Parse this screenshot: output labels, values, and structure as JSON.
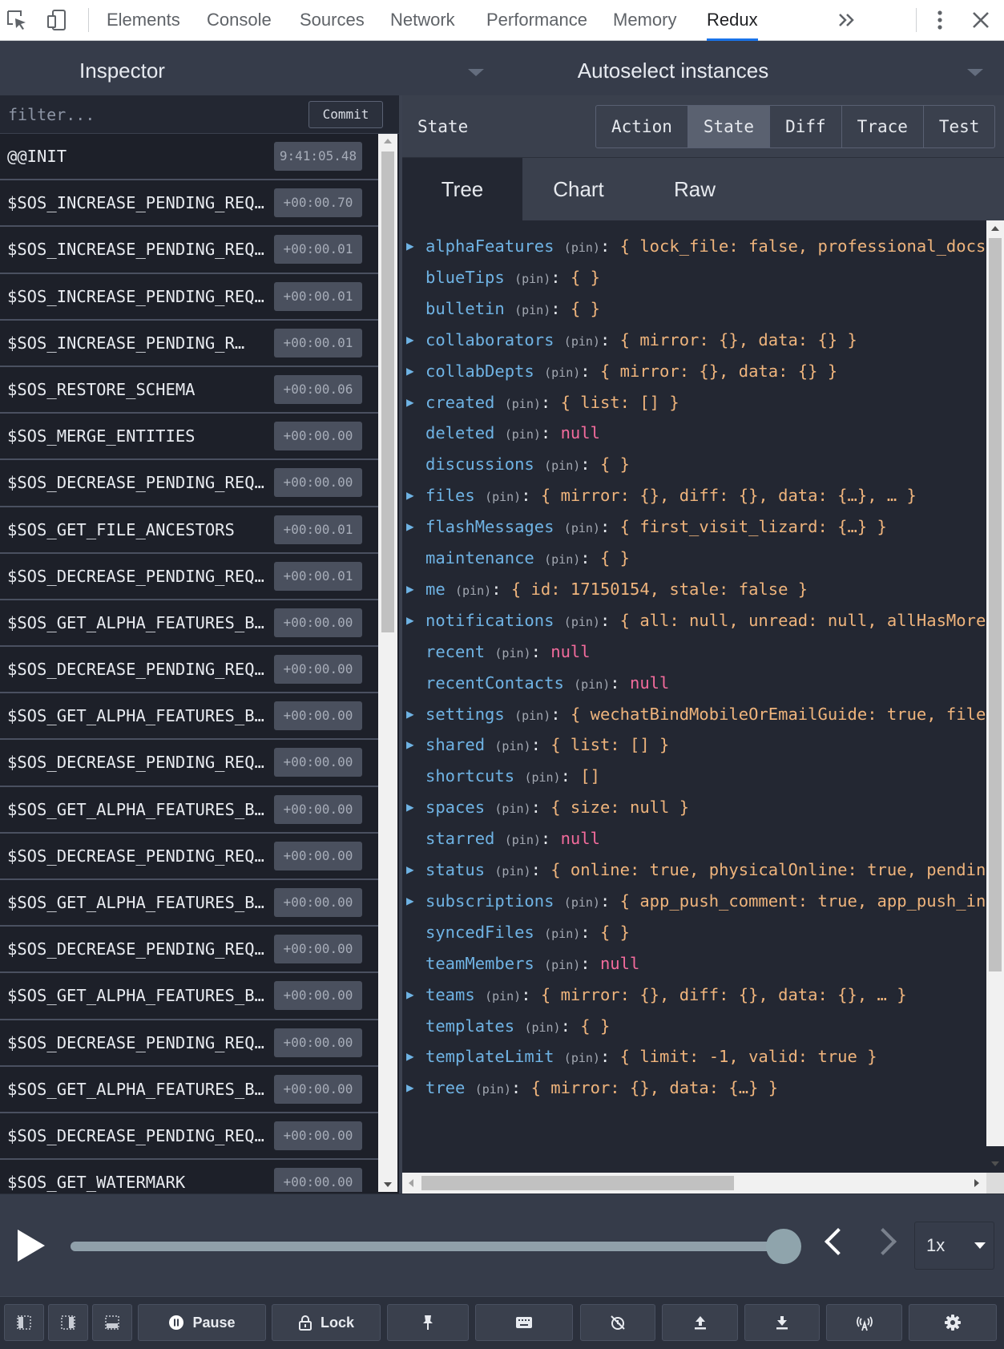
{
  "devtools": {
    "tabs": [
      "Elements",
      "Console",
      "Sources",
      "Network",
      "Performance",
      "Memory",
      "Redux"
    ],
    "active_tab": "Redux",
    "icons": [
      "inspect-element-icon",
      "device-toolbar-icon",
      "more-tabs-icon",
      "kebab-menu-icon",
      "close-icon"
    ]
  },
  "header": {
    "left_title": "Inspector",
    "right_title": "Autoselect instances"
  },
  "filter": {
    "placeholder": "filter...",
    "commit_label": "Commit"
  },
  "actions": [
    {
      "name": "@@INIT",
      "time": "9:41:05.48"
    },
    {
      "name": "$SOS_INCREASE_PENDING_REQ…",
      "time": "+00:00.70"
    },
    {
      "name": "$SOS_INCREASE_PENDING_REQ…",
      "time": "+00:00.01"
    },
    {
      "name": "$SOS_INCREASE_PENDING_REQ…",
      "time": "+00:00.01"
    },
    {
      "name": "$SOS_INCREASE_PENDING_R…",
      "time": "+00:00.01"
    },
    {
      "name": "$SOS_RESTORE_SCHEMA",
      "time": "+00:00.06"
    },
    {
      "name": "$SOS_MERGE_ENTITIES",
      "time": "+00:00.00"
    },
    {
      "name": "$SOS_DECREASE_PENDING_REQ…",
      "time": "+00:00.00"
    },
    {
      "name": "$SOS_GET_FILE_ANCESTORS",
      "time": "+00:00.01"
    },
    {
      "name": "$SOS_DECREASE_PENDING_REQ…",
      "time": "+00:00.01"
    },
    {
      "name": "$SOS_GET_ALPHA_FEATURES_B…",
      "time": "+00:00.00"
    },
    {
      "name": "$SOS_DECREASE_PENDING_REQ…",
      "time": "+00:00.00"
    },
    {
      "name": "$SOS_GET_ALPHA_FEATURES_B…",
      "time": "+00:00.00"
    },
    {
      "name": "$SOS_DECREASE_PENDING_REQ…",
      "time": "+00:00.00"
    },
    {
      "name": "$SOS_GET_ALPHA_FEATURES_B…",
      "time": "+00:00.00"
    },
    {
      "name": "$SOS_DECREASE_PENDING_REQ…",
      "time": "+00:00.00"
    },
    {
      "name": "$SOS_GET_ALPHA_FEATURES_B…",
      "time": "+00:00.00"
    },
    {
      "name": "$SOS_DECREASE_PENDING_REQ…",
      "time": "+00:00.00"
    },
    {
      "name": "$SOS_GET_ALPHA_FEATURES_B…",
      "time": "+00:00.00"
    },
    {
      "name": "$SOS_DECREASE_PENDING_REQ…",
      "time": "+00:00.00"
    },
    {
      "name": "$SOS_GET_ALPHA_FEATURES_B…",
      "time": "+00:00.00"
    },
    {
      "name": "$SOS_DECREASE_PENDING_REQ…",
      "time": "+00:00.00"
    },
    {
      "name": "$SOS_GET_WATERMARK",
      "time": "+00:00.00"
    }
  ],
  "monitor": {
    "label": "State",
    "tabs": [
      "Action",
      "State",
      "Diff",
      "Trace",
      "Test"
    ],
    "active_tab": "State",
    "view_tabs": [
      "Tree",
      "Chart",
      "Raw"
    ],
    "active_view": "Tree"
  },
  "state_tree": [
    {
      "key": "alphaFeatures",
      "pin": "(pin)",
      "value": "{ lock_file: false, professional_docs: ",
      "type": "object",
      "expandable": true
    },
    {
      "key": "blueTips",
      "pin": "(pin)",
      "value": "{ }",
      "type": "object",
      "expandable": false
    },
    {
      "key": "bulletin",
      "pin": "(pin)",
      "value": "{ }",
      "type": "object",
      "expandable": false
    },
    {
      "key": "collaborators",
      "pin": "(pin)",
      "value": "{ mirror: {}, data: {} }",
      "type": "object",
      "expandable": true
    },
    {
      "key": "collabDepts",
      "pin": "(pin)",
      "value": "{ mirror: {}, data: {} }",
      "type": "object",
      "expandable": true
    },
    {
      "key": "created",
      "pin": "(pin)",
      "value": "{ list: [] }",
      "type": "object",
      "expandable": true
    },
    {
      "key": "deleted",
      "pin": "(pin)",
      "value": "null",
      "type": "null",
      "expandable": false
    },
    {
      "key": "discussions",
      "pin": "(pin)",
      "value": "{ }",
      "type": "object",
      "expandable": false
    },
    {
      "key": "files",
      "pin": "(pin)",
      "value": "{ mirror: {}, diff: {}, data: {…}, … }",
      "type": "object",
      "expandable": true
    },
    {
      "key": "flashMessages",
      "pin": "(pin)",
      "value": "{ first_visit_lizard: {…} }",
      "type": "object",
      "expandable": true
    },
    {
      "key": "maintenance",
      "pin": "(pin)",
      "value": "{ }",
      "type": "object",
      "expandable": false
    },
    {
      "key": "me",
      "pin": "(pin)",
      "value": "{ id: 17150154, stale: false }",
      "type": "object",
      "expandable": true
    },
    {
      "key": "notifications",
      "pin": "(pin)",
      "value": "{ all: null, unread: null, allHasMore:",
      "type": "object",
      "expandable": true
    },
    {
      "key": "recent",
      "pin": "(pin)",
      "value": "null",
      "type": "null",
      "expandable": false
    },
    {
      "key": "recentContacts",
      "pin": "(pin)",
      "value": "null",
      "type": "null",
      "expandable": false
    },
    {
      "key": "settings",
      "pin": "(pin)",
      "value": "{ wechatBindMobileOrEmailGuide: true, fileL",
      "type": "object",
      "expandable": true
    },
    {
      "key": "shared",
      "pin": "(pin)",
      "value": "{ list: [] }",
      "type": "object",
      "expandable": true
    },
    {
      "key": "shortcuts",
      "pin": "(pin)",
      "value": "[]",
      "type": "object",
      "expandable": false
    },
    {
      "key": "spaces",
      "pin": "(pin)",
      "value": "{ size: null }",
      "type": "object",
      "expandable": true
    },
    {
      "key": "starred",
      "pin": "(pin)",
      "value": "null",
      "type": "null",
      "expandable": false
    },
    {
      "key": "status",
      "pin": "(pin)",
      "value": "{ online: true, physicalOnline: true, pending",
      "type": "object",
      "expandable": true
    },
    {
      "key": "subscriptions",
      "pin": "(pin)",
      "value": "{ app_push_comment: true, app_push_inv",
      "type": "object",
      "expandable": true
    },
    {
      "key": "syncedFiles",
      "pin": "(pin)",
      "value": "{ }",
      "type": "object",
      "expandable": false
    },
    {
      "key": "teamMembers",
      "pin": "(pin)",
      "value": "null",
      "type": "null",
      "expandable": false
    },
    {
      "key": "teams",
      "pin": "(pin)",
      "value": "{ mirror: {}, diff: {}, data: {}, … }",
      "type": "object",
      "expandable": true
    },
    {
      "key": "templates",
      "pin": "(pin)",
      "value": "{ }",
      "type": "object",
      "expandable": false
    },
    {
      "key": "templateLimit",
      "pin": "(pin)",
      "value": "{ limit: -1, valid: true }",
      "type": "object",
      "expandable": true
    },
    {
      "key": "tree",
      "pin": "(pin)",
      "value": "{ mirror: {}, data: {…} }",
      "type": "object",
      "expandable": true
    }
  ],
  "slider": {
    "progress": 1.0,
    "speed": "1x"
  },
  "toolbar": {
    "pause_label": "Pause",
    "lock_label": "Lock",
    "icons": [
      "left-panel-icon",
      "right-panel-icon",
      "bottom-panel-icon",
      "pin-icon",
      "keyboard-icon",
      "persist-icon",
      "import-icon",
      "export-icon",
      "remote-icon",
      "settings-icon"
    ]
  },
  "colors": {
    "tree_key": "#6fb3e4",
    "tree_object": "#efb47c",
    "tree_null": "#f26b9c",
    "active_devtools_tab": "#1a73e8"
  }
}
